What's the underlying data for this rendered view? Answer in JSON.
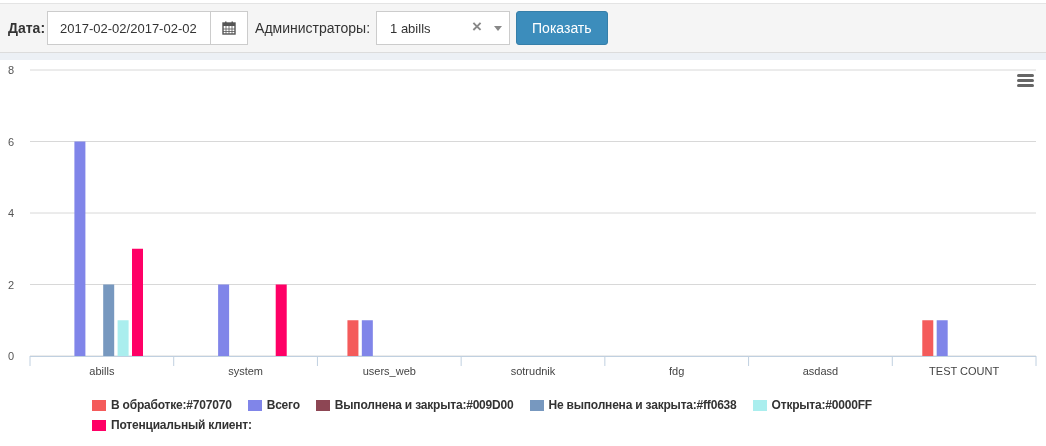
{
  "filter": {
    "date_label": "Дата:",
    "date_value": "2017-02-02/2017-02-02",
    "admins_label": "Администраторы:",
    "admins_value": "1 abills",
    "clear_glyph": "×",
    "submit": "Показать"
  },
  "chart": {
    "chart_data": {
      "type": "bar",
      "categories": [
        "abills",
        "system",
        "users_web",
        "sotrudnik",
        "fdg",
        "asdasd",
        "TEST COUNT"
      ],
      "ylim": [
        0,
        8
      ],
      "grid": true,
      "legend": true,
      "yticks": [
        0,
        2,
        4,
        6,
        8
      ],
      "series": [
        {
          "name": "В обработке:#707070",
          "color": "#f45b5b",
          "values": [
            0,
            0,
            1,
            0,
            0,
            0,
            1
          ]
        },
        {
          "name": "Всего",
          "color": "#8085e9",
          "values": [
            6,
            2,
            1,
            0,
            0,
            0,
            1
          ]
        },
        {
          "name": "Выполнена и закрыта:#009D00",
          "color": "#8d4654",
          "values": [
            0,
            0,
            0,
            0,
            0,
            0,
            0
          ]
        },
        {
          "name": "Не выполнена и закрыта:#ff0638",
          "color": "#7798bf",
          "values": [
            2,
            0,
            0,
            0,
            0,
            0,
            0
          ]
        },
        {
          "name": "Открыта:#0000FF",
          "color": "#aaeeee",
          "values": [
            1,
            0,
            0,
            0,
            0,
            0,
            0
          ]
        },
        {
          "name": "Потенциальный клиент:",
          "color": "#ff0066",
          "values": [
            3,
            2,
            0,
            0,
            0,
            0,
            0
          ]
        }
      ]
    }
  }
}
